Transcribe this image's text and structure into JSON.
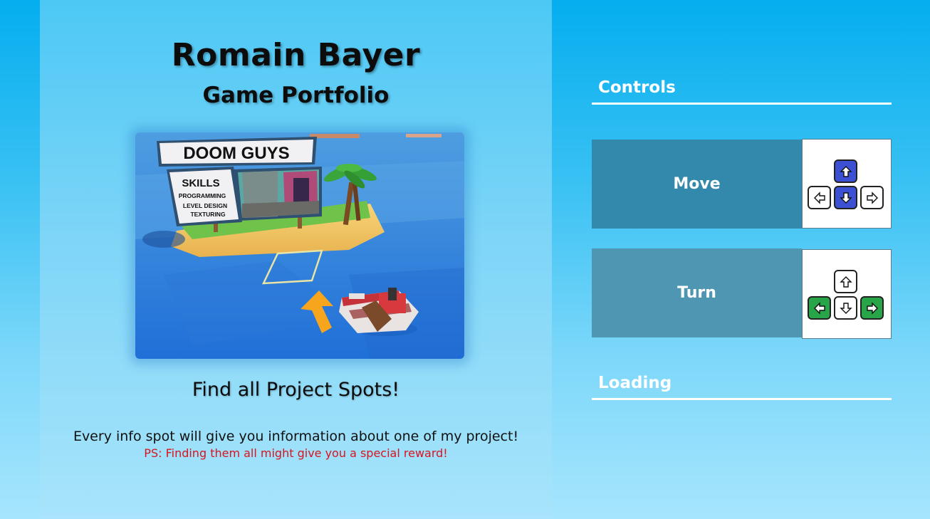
{
  "header": {
    "title": "Romain Bayer",
    "subtitle": "Game Portfolio"
  },
  "preview": {
    "sign_title": "DOOM GUYS",
    "skills_heading": "SKILLS",
    "skills": [
      "PROGRAMMING",
      "LEVEL DESIGN",
      "TEXTURING"
    ]
  },
  "tagline": "Find all Project Spots!",
  "info_text": "Every info spot will give you information about one of my project!",
  "ps_text": "PS: Finding them all might give you a special reward!",
  "controls": {
    "heading": "Controls",
    "move": {
      "label": "Move",
      "highlight_color": "#3b50d2",
      "active_keys": [
        "up",
        "down"
      ]
    },
    "turn": {
      "label": "Turn",
      "highlight_color": "#27a548",
      "active_keys": [
        "left",
        "right"
      ]
    }
  },
  "loading": {
    "heading": "Loading"
  },
  "colors": {
    "move_panel": "#3389ac",
    "turn_panel": "#4f96b2",
    "ps_text": "#d8141e"
  }
}
